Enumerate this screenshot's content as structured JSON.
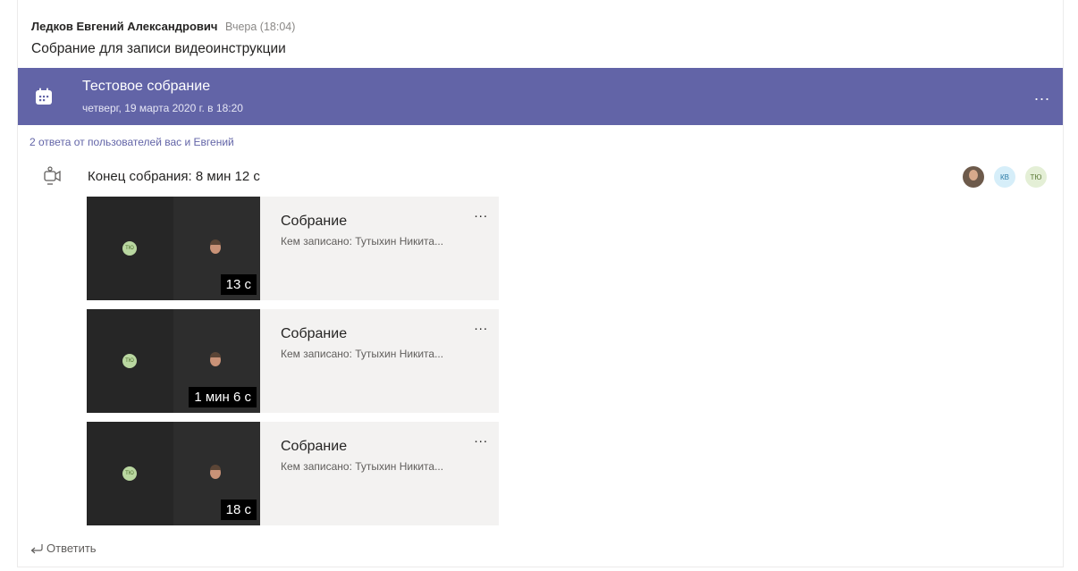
{
  "post": {
    "author": "Ледков Евгений Александрович",
    "time": "Вчера (18:04)",
    "subject": "Собрание для записи видеоинструкции"
  },
  "meeting": {
    "title": "Тестовое собрание",
    "date": "четверг, 19 марта 2020 г. в 18:20",
    "more": "..."
  },
  "replies_link": "2 ответа от пользователей вас и Евгений",
  "meeting_end": {
    "label": "Конец собрания: 8 мин 12 с",
    "avatars": [
      {
        "type": "photo",
        "initials": ""
      },
      {
        "type": "initials",
        "initials": "КВ"
      },
      {
        "type": "initials",
        "initials": "ТЮ"
      }
    ]
  },
  "recordings": [
    {
      "title": "Собрание",
      "recorded_by": "Кем записано: Тутыхин Никита...",
      "duration": "13 с",
      "thumb_initials": "ТЮ",
      "more": "..."
    },
    {
      "title": "Собрание",
      "recorded_by": "Кем записано: Тутыхин Никита...",
      "duration": "1 мин 6 с",
      "thumb_initials": "ТЮ",
      "more": "..."
    },
    {
      "title": "Собрание",
      "recorded_by": "Кем записано: Тутыхин Никита...",
      "duration": "18 с",
      "thumb_initials": "ТЮ",
      "more": "..."
    }
  ],
  "reply_label": "Ответить",
  "colors": {
    "accent": "#6264a7",
    "card_bg": "#f3f2f1",
    "thumb_bg": "#292929"
  }
}
